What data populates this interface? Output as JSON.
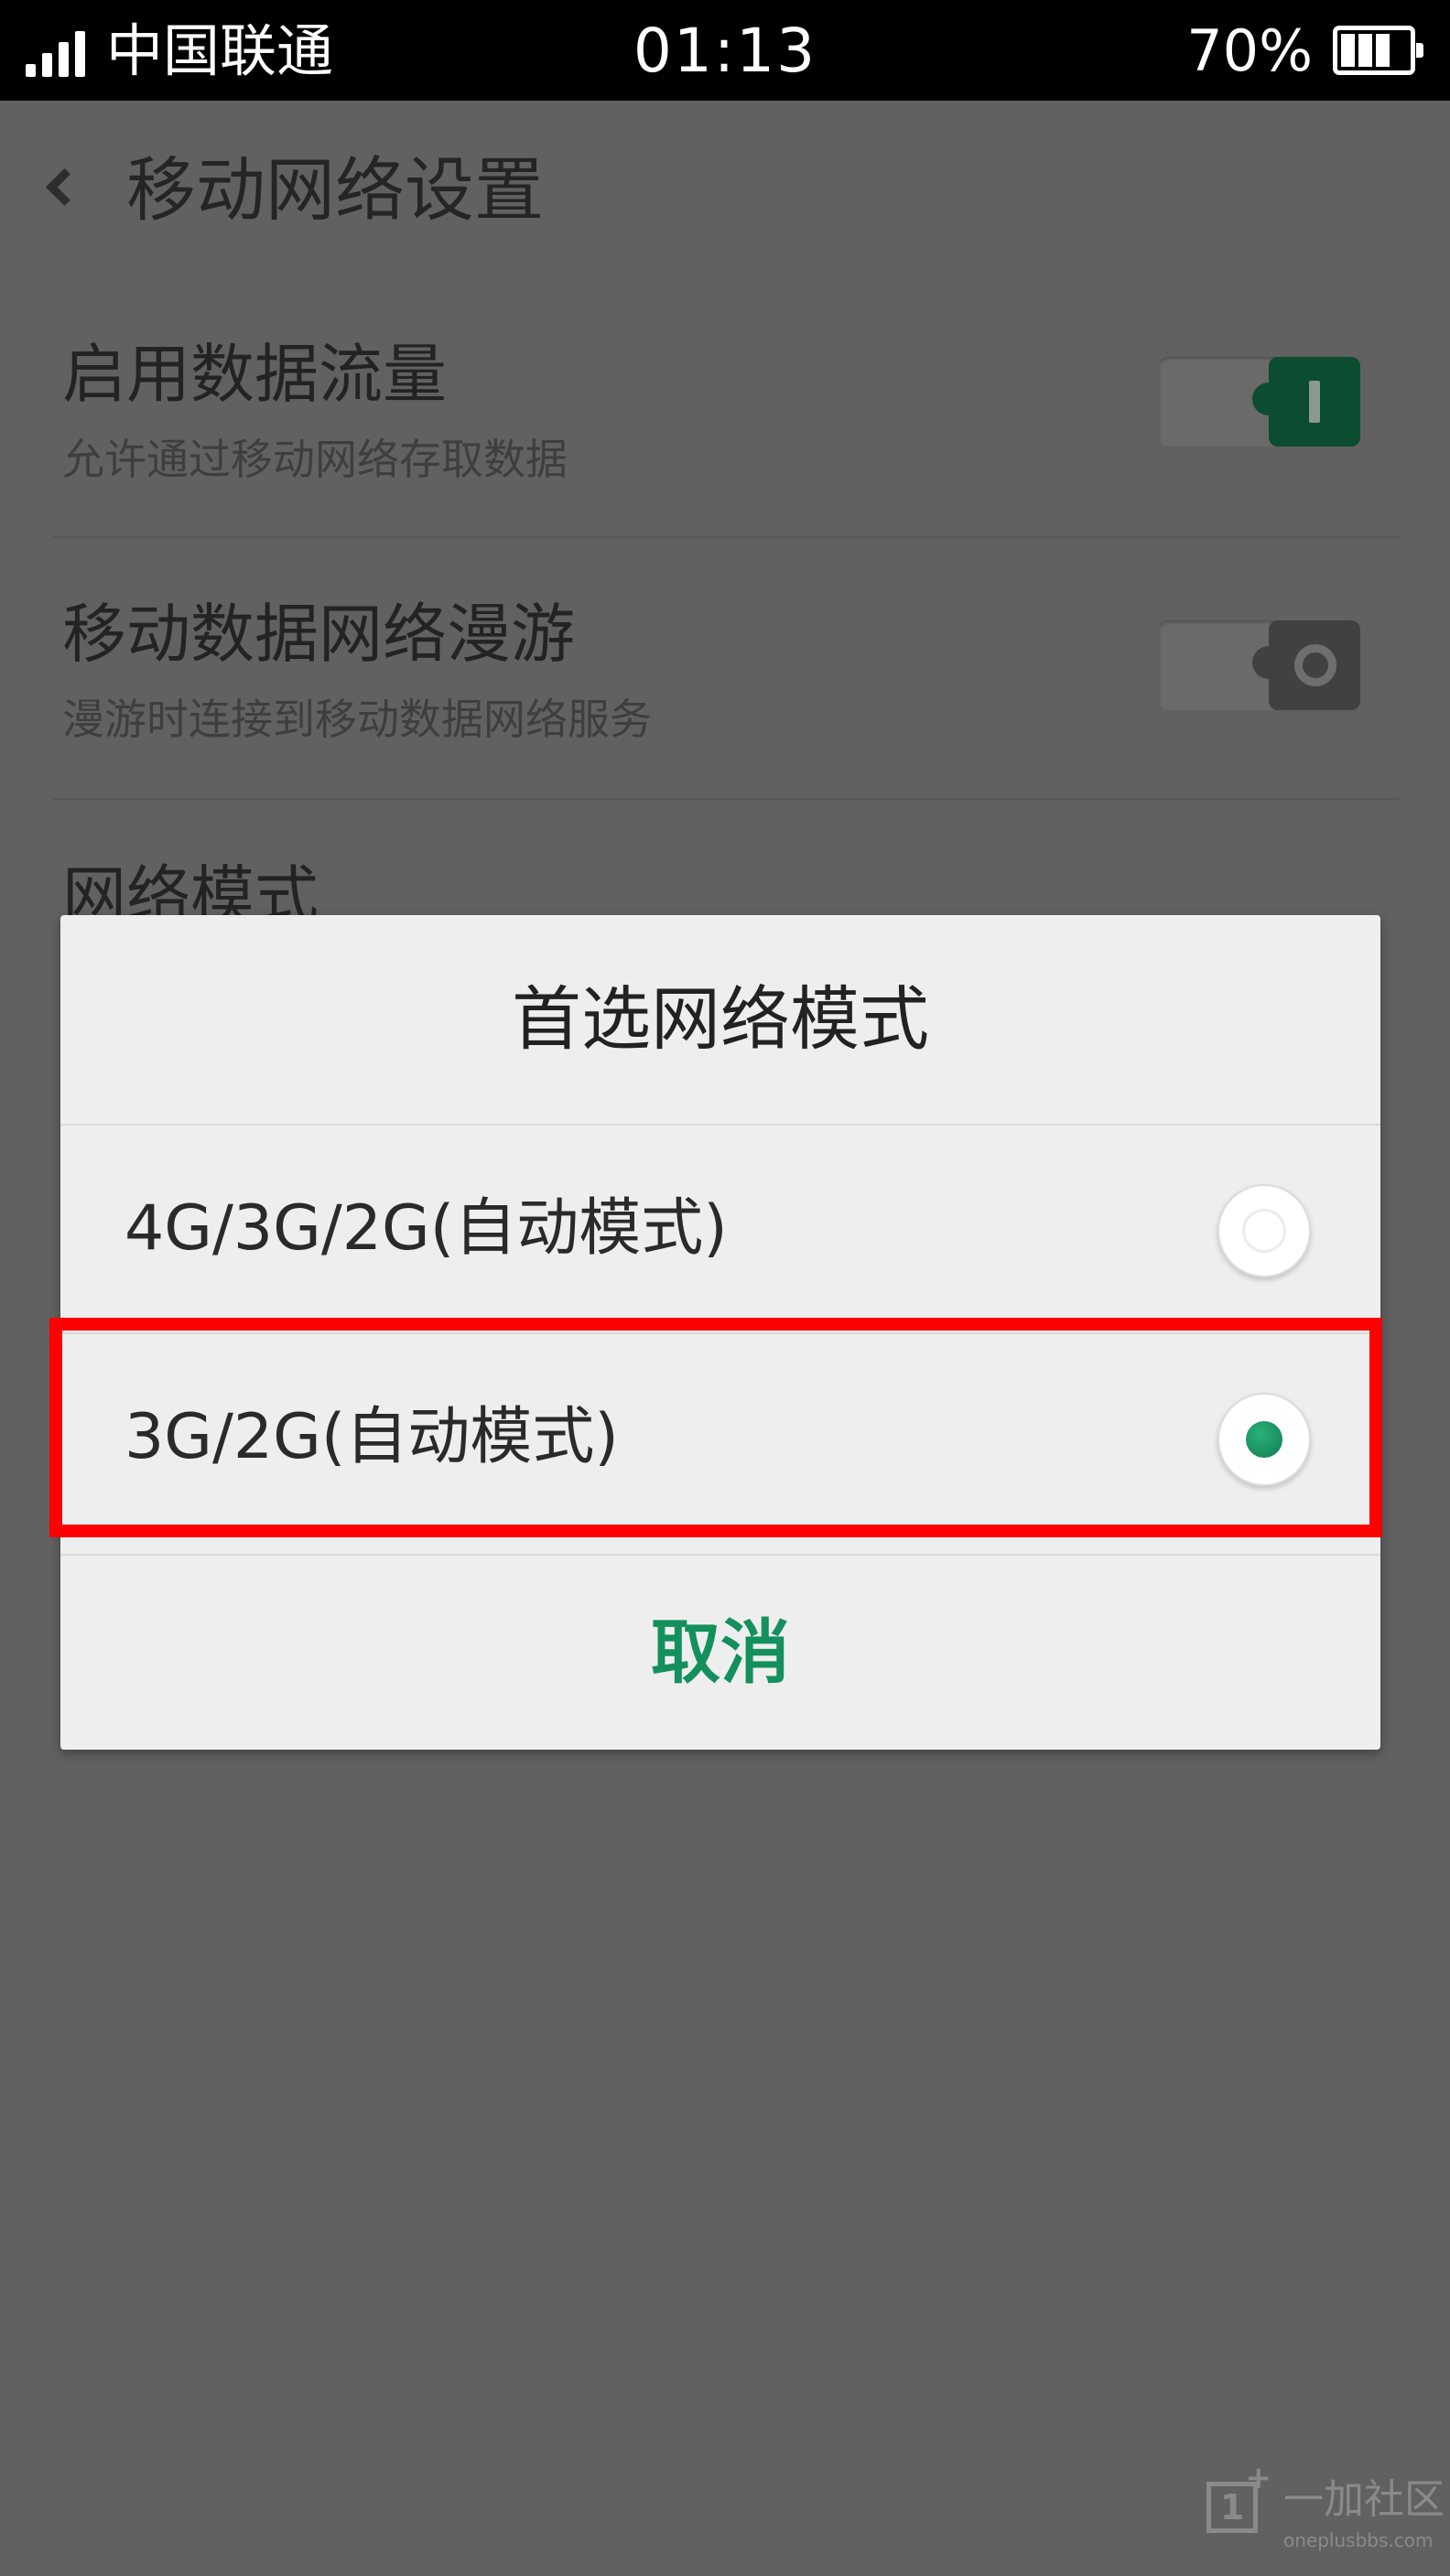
{
  "status_bar": {
    "carrier": "中国联通",
    "time": "01:13",
    "battery_percent": "70%",
    "signal_level": "4 of 4 bars",
    "battery_level": 0.7,
    "icons": [
      "signal-icon",
      "battery-icon"
    ]
  },
  "header": {
    "back_icon": "back-icon",
    "title": "移动网络设置"
  },
  "settings": {
    "items": [
      {
        "title": "启用数据流量",
        "subtitle": "允许通过移动网络存取数据",
        "toggle_on": true
      },
      {
        "title": "移动数据网络漫游",
        "subtitle": "漫游时连接到移动数据网络服务",
        "toggle_on": false
      },
      {
        "title": "网络模式"
      }
    ]
  },
  "dialog": {
    "title": "首选网络模式",
    "options": [
      {
        "label": "4G/3G/2G(自动模式)",
        "selected": false
      },
      {
        "label": "3G/2G(自动模式)",
        "selected": true
      }
    ],
    "cancel_label": "取消"
  },
  "watermark": {
    "text": "一加社区",
    "domain": "oneplusbbs.com"
  },
  "colors": {
    "dim_background": "#616161",
    "accent_green": "#13905c",
    "highlight_red": "#ff0000",
    "dialog_background": "#eeeeee"
  }
}
